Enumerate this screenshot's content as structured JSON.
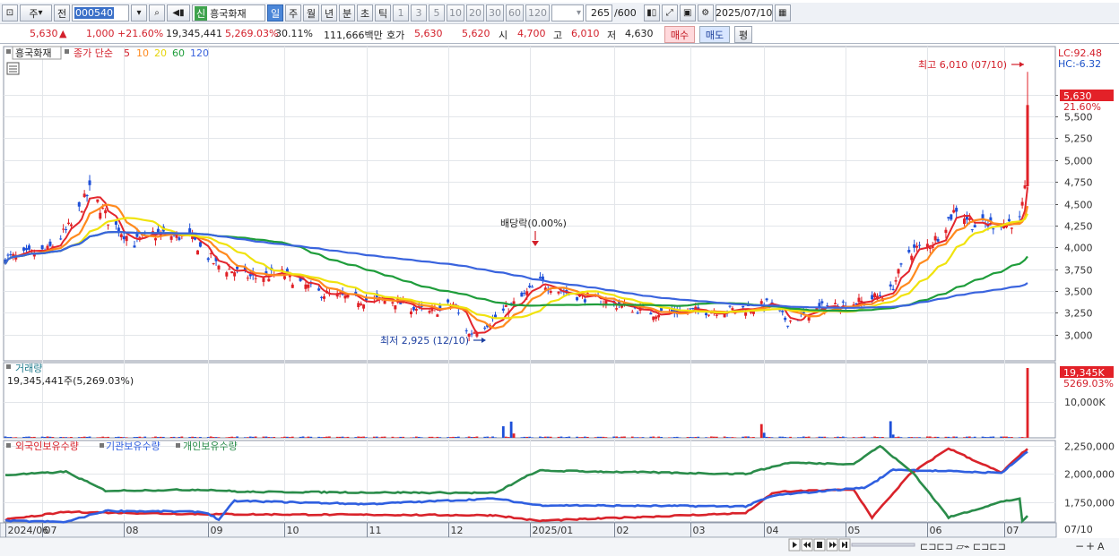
{
  "toolbar": {
    "market_type": "주",
    "jeon": "전",
    "code": "000540",
    "sin_badge": "신",
    "stock_name": "흥국화재",
    "periods": [
      "일",
      "주",
      "월",
      "년",
      "분",
      "초",
      "틱"
    ],
    "active_period": "일",
    "minute_values": [
      "1",
      "3",
      "5",
      "10",
      "20",
      "30",
      "60",
      "120"
    ],
    "bar_count": "265",
    "bar_total": "/600",
    "date": "2025/07/10"
  },
  "quote": {
    "price": "5,630",
    "change_arrow": "▲",
    "change": "1,000",
    "change_pct": "+21.60%",
    "volume": "19,345,441",
    "volume_ratio": "5,269.03%",
    "turnover": "30.11%",
    "amount": "111,666백만",
    "hoga_label": "호가",
    "ask": "5,630",
    "bid": "5,620",
    "open_label": "시",
    "open": "4,700",
    "high_label": "고",
    "high": "6,010",
    "low_label": "저",
    "low": "4,630",
    "buy_label": "매수",
    "sell_label": "매도",
    "eval_label": "평"
  },
  "legend": {
    "name": "흥국화재",
    "ma_label": "종가 단순",
    "ma_periods": [
      "5",
      "10",
      "20",
      "60",
      "120"
    ],
    "ma_colors": [
      "#e3262d",
      "#ff8a1e",
      "#f0e30e",
      "#1f9d3b",
      "#3a64de"
    ]
  },
  "price_panel": {
    "lc": "LC:92.48",
    "hc": "HC:-6.32",
    "current_tag": "5,630",
    "pct_tag": "21.60%",
    "max_label": "최고 6,010 (07/10)",
    "min_label": "최저 2,925 (12/10)",
    "dividend_label": "배당락(0.00%)"
  },
  "volume_panel": {
    "title": "거래량",
    "summary": "19,345,441주(5,269.03%)",
    "current_tag": "19,345K",
    "pct_tag": "5269.03%",
    "axis_label": "10,000K"
  },
  "holding_panel": {
    "title_foreign": "외국인보유수량",
    "title_inst": "기관보유수량",
    "title_indiv": "개인보유수량",
    "colors": {
      "foreign": "#d9232b",
      "inst": "#2f5fe0",
      "indiv": "#2a8c4a"
    }
  },
  "x_axis": {
    "labels": [
      "2024/06",
      "07",
      "08",
      "09",
      "10",
      "11",
      "12",
      "2025/01",
      "02",
      "03",
      "04",
      "05",
      "06",
      "07"
    ],
    "right_label": "07/10"
  },
  "chart_data": {
    "type": "candlestick",
    "price_axis": {
      "ticks": [
        "5,750",
        "5,500",
        "5,250",
        "5,000",
        "4,750",
        "4,500",
        "4,250",
        "4,000",
        "3,750",
        "3,500",
        "3,250",
        "3,000"
      ],
      "range": [
        2700,
        6300
      ]
    },
    "volume_axis": {
      "ticks": [
        "10,000K"
      ],
      "range": [
        0,
        19345
      ]
    },
    "holding_axis": {
      "ticks": [
        "2,250,000",
        "2,000,000",
        "1,750,000"
      ],
      "range": [
        1570000,
        2300000
      ]
    },
    "price_path_anchors": [
      [
        "2024/06/20",
        3880
      ],
      [
        "2024/07/03",
        3960
      ],
      [
        "2024/07/12",
        4250
      ],
      [
        "2024/07/19",
        4650
      ],
      [
        "2024/07/26",
        4320
      ],
      [
        "2024/08/05",
        4050
      ],
      [
        "2024/08/12",
        4150
      ],
      [
        "2024/08/26",
        4120
      ],
      [
        "2024/09/05",
        3800
      ],
      [
        "2024/09/19",
        3650
      ],
      [
        "2024/09/30",
        3700
      ],
      [
        "2024/10/14",
        3480
      ],
      [
        "2024/10/28",
        3400
      ],
      [
        "2024/11/11",
        3390
      ],
      [
        "2024/11/25",
        3250
      ],
      [
        "2024/12/04",
        3350
      ],
      [
        "2024/12/10",
        3000
      ],
      [
        "2024/12/18",
        3150
      ],
      [
        "2024/12/27",
        3350
      ],
      [
        "2025/01/06",
        3600
      ],
      [
        "2025/01/16",
        3480
      ],
      [
        "2025/02/03",
        3350
      ],
      [
        "2025/02/18",
        3250
      ],
      [
        "2025/03/05",
        3270
      ],
      [
        "2025/03/20",
        3280
      ],
      [
        "2025/03/31",
        3330
      ],
      [
        "2025/04/03",
        3350
      ],
      [
        "2025/04/10",
        3150
      ],
      [
        "2025/04/24",
        3320
      ],
      [
        "2025/05/09",
        3380
      ],
      [
        "2025/05/19",
        3500
      ],
      [
        "2025/05/26",
        3950
      ],
      [
        "2025/06/04",
        4050
      ],
      [
        "2025/06/13",
        4450
      ],
      [
        "2025/06/20",
        4250
      ],
      [
        "2025/06/30",
        4280
      ],
      [
        "2025/07/07",
        4300
      ],
      [
        "2025/07/09",
        4630
      ],
      [
        "2025/07/10",
        5630
      ]
    ],
    "moving_averages": [
      "5",
      "10",
      "20",
      "60",
      "120"
    ],
    "dividend_date": "2024/12/26",
    "price_high": 6010,
    "price_low": 2925
  }
}
